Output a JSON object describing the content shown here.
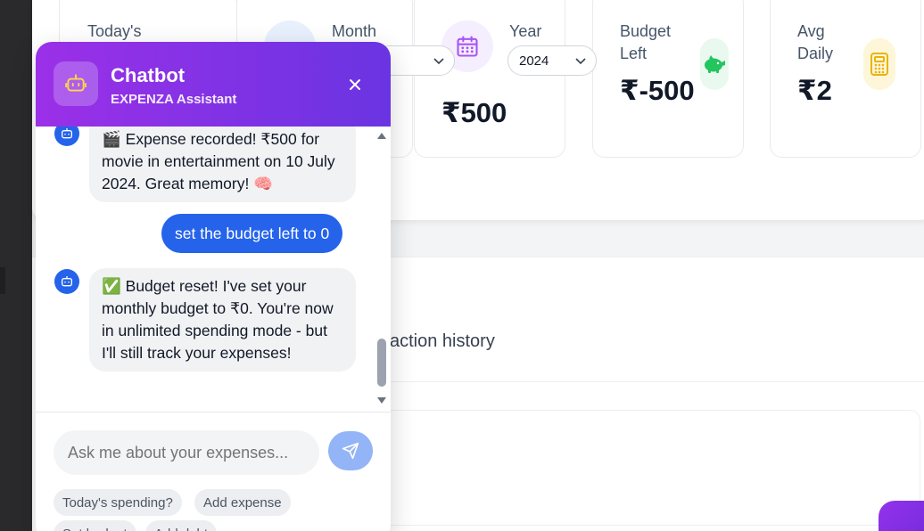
{
  "colors": {
    "accent": "#2563eb",
    "header_gradient_start": "#9b30e8",
    "header_gradient_end": "#6a34e2",
    "budget_green": "#22c55e",
    "avg_yellow": "#eab308",
    "calendar_purple": "#a855f7"
  },
  "stats": {
    "today": {
      "label_line1": "Today's",
      "icon": "spending-icon"
    },
    "month": {
      "label": "Month",
      "selected": "",
      "icon": "month-icon"
    },
    "year": {
      "label": "Year",
      "selected": "2024",
      "value": "₹500",
      "icon": "calendar-icon"
    },
    "budget_left": {
      "label_line1": "Budget",
      "label_line2": "Left",
      "value": "₹-500",
      "icon": "piggy-bank-icon"
    },
    "avg_daily": {
      "label_line1": "Avg",
      "label_line2": "Daily",
      "value": "₹2",
      "icon": "calculator-icon"
    }
  },
  "main": {
    "history_text": "action history"
  },
  "chatbot": {
    "title": "Chatbot",
    "subtitle": "EXPENZA Assistant",
    "messages": [
      {
        "from": "bot",
        "text": "🎬 Expense recorded! ₹500 for movie in entertainment on 10 July 2024. Great memory! 🧠"
      },
      {
        "from": "user",
        "text": "set the budget left to 0"
      },
      {
        "from": "bot",
        "text": "✅ Budget reset! I've set your monthly budget to ₹0. You're now in unlimited spending mode - but I'll still track your expenses!"
      }
    ],
    "input_placeholder": "Ask me about your expenses...",
    "suggestions": [
      "Today's spending?",
      "Add expense",
      "Set budget",
      "Add debt"
    ]
  }
}
